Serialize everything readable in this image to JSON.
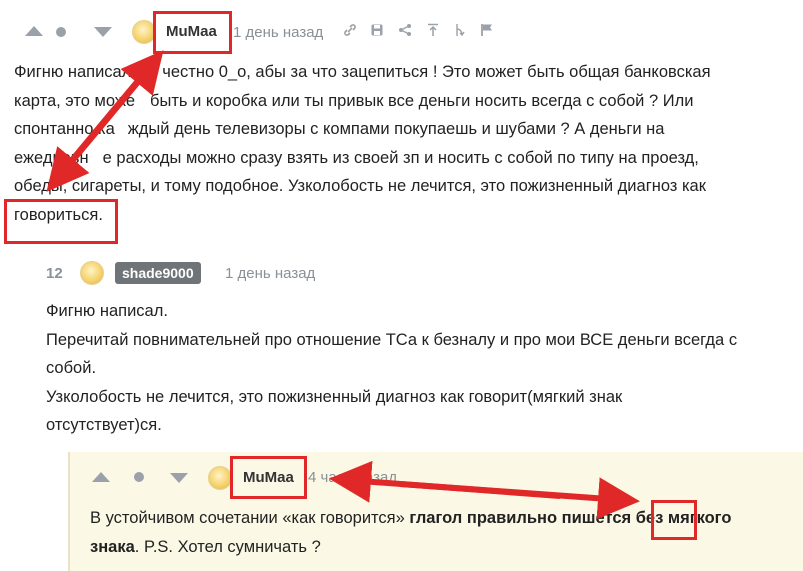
{
  "comment1": {
    "username": "MuMaa",
    "time": "1 день назад",
    "icons": [
      "link-icon",
      "save-icon",
      "share-icon",
      "branch-up-icon",
      "branch-icon",
      "flag-icon"
    ],
    "text_lines": [
      "Фигню написал, в",
      "честно 0_о, абы за что зацепиться ! Это может быть общая банковская",
      "карта, это може",
      "быть и коробка или ты привык все деньги носить всегда с собой ? Или",
      "спонтанно ка",
      "ждый день телевизоры с компами покупаешь и шубами ? А деньги на",
      "ежедневн",
      "е расходы можно сразу взять из своей зп и носить с собой по типу на проезд,",
      "обеды, сигареты, и тому подобное. Узколобость не лечится, это пожизненный диагноз как",
      "говориться."
    ]
  },
  "comment2": {
    "rating": "12",
    "username": "shade9000",
    "time": "1 день назад",
    "text_lines": [
      "Фигню написал.",
      "Перечитай повнимательней про отношение ТСа к безналу и про мои ВСЕ деньги всегда с",
      "собой.",
      "Узколобость не лечится, это пожизненный диагноз как говорит(мягкий знак",
      "отсутствует)ся."
    ]
  },
  "comment3": {
    "username": "MuMaa",
    "time": "4 часа назад",
    "text_part1": "В устойчивом сочетании «как говорится» ",
    "text_bold1": "глагол правильно пишется без мягкого",
    "text_bold2": "знака",
    "text_part2": ". P.S. Хотел сумничать ?"
  },
  "annotation_color": "#e02828"
}
